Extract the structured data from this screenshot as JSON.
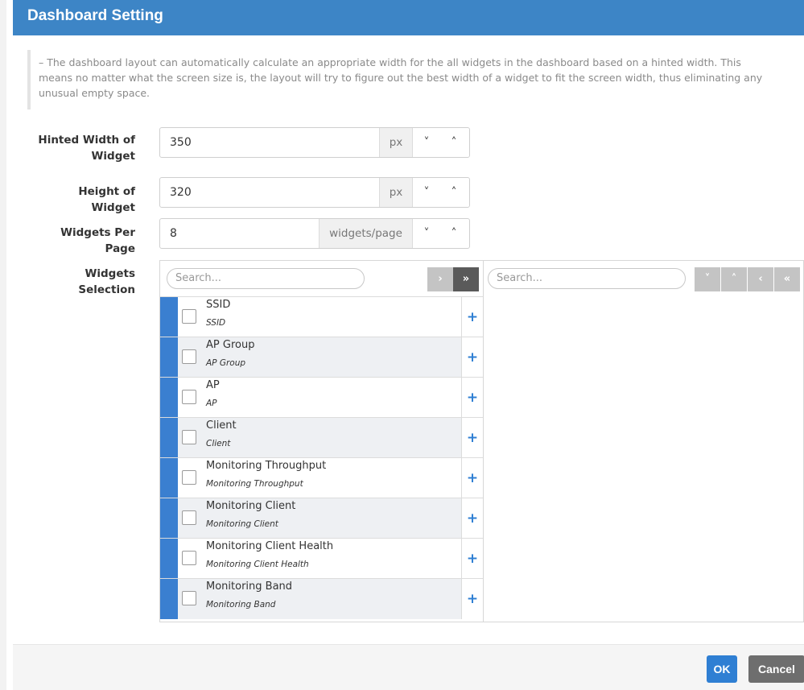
{
  "dialog": {
    "title": "Dashboard Setting",
    "description": "– The dashboard layout can automatically calculate an appropriate width for the all widgets in the dashboard based on a hinted width. This means no matter what the screen size is, the layout will try to figure out the best width of a widget to fit the screen width, thus eliminating any unusual empty space."
  },
  "fields": {
    "hinted_width": {
      "label_line1": "Hinted Width of",
      "label_line2": "Widget",
      "value": "350",
      "unit": "px"
    },
    "height": {
      "label": "Height of Widget",
      "value": "320",
      "unit": "px"
    },
    "per_page": {
      "label": "Widgets Per Page",
      "value": "8",
      "unit": "widgets/page"
    }
  },
  "selection": {
    "label": "Widgets Selection",
    "left_search_placeholder": "Search...",
    "right_search_placeholder": "Search...",
    "move_one_right": "›",
    "move_all_right": "»",
    "move_down": "˅",
    "move_up": "˄",
    "move_one_left": "‹",
    "move_all_left": "«",
    "items": [
      {
        "name": "SSID",
        "sub": "SSID"
      },
      {
        "name": "AP Group",
        "sub": "AP Group"
      },
      {
        "name": "AP",
        "sub": "AP"
      },
      {
        "name": "Client",
        "sub": "Client"
      },
      {
        "name": "Monitoring Throughput",
        "sub": "Monitoring Throughput"
      },
      {
        "name": "Monitoring Client",
        "sub": "Monitoring Client"
      },
      {
        "name": "Monitoring Client Health",
        "sub": "Monitoring Client Health"
      },
      {
        "name": "Monitoring Band",
        "sub": "Monitoring Band"
      }
    ],
    "add_glyph": "+"
  },
  "spinner": {
    "down": "˅",
    "up": "˄"
  },
  "footer": {
    "ok_label": "OK",
    "cancel_label": "Cancel"
  },
  "colors": {
    "title_bar": "#3d85c6",
    "accent_bar": "#3a7fd0",
    "ok_button": "#2f7fd3",
    "cancel_button": "#6e6e6e"
  }
}
